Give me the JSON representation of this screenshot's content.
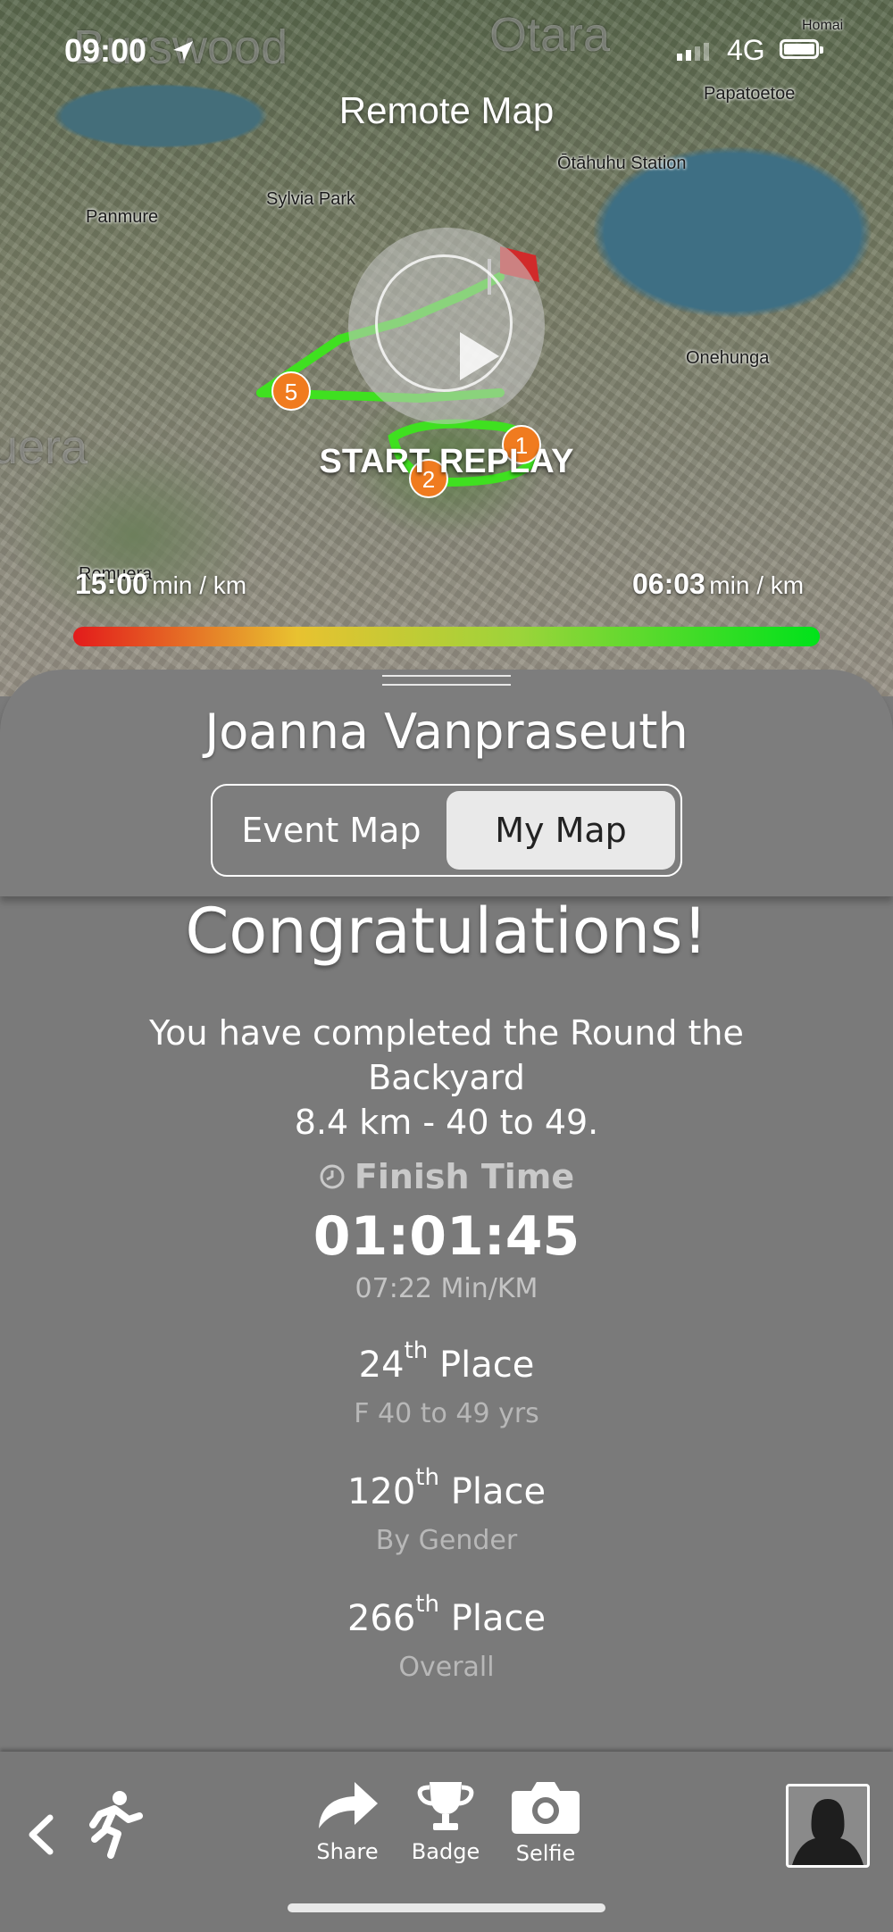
{
  "status_bar": {
    "time": "09:00",
    "network": "4G"
  },
  "map": {
    "title": "Remote Map",
    "places": [
      "Burswood",
      "Otara",
      "Papatoetoe",
      "Homai",
      "Sylvia Park",
      "Panmure",
      "Ōtāhuhu Station",
      "Onehunga",
      "Remuera",
      "uera"
    ],
    "replay_label": "START REPLAY",
    "markers": [
      "5",
      "1",
      "2"
    ],
    "pace_slow_value": "15:00",
    "pace_fast_value": "06:03",
    "pace_unit": "min / km",
    "colors": {
      "slow": "#e31b1b",
      "fast": "#00e21a",
      "route": "#3fe020",
      "marker": "#f07b1f"
    }
  },
  "panel": {
    "runner_name": "Joanna Vanpraseuth",
    "tabs": [
      {
        "label": "Event Map",
        "selected": false
      },
      {
        "label": "My Map",
        "selected": true
      }
    ]
  },
  "result": {
    "heading": "Congratulations!",
    "message_line1": "You have completed the Round the Backyard",
    "message_line2": "8.4 km - 40 to 49.",
    "finish_label": "Finish Time",
    "finish_time": "01:01:45",
    "finish_pace": "07:22 Min/KM",
    "places": [
      {
        "number": "24",
        "suffix": "th",
        "word": "Place",
        "subtitle": "F 40 to 49 yrs"
      },
      {
        "number": "120",
        "suffix": "th",
        "word": "Place",
        "subtitle": "By Gender"
      },
      {
        "number": "266",
        "suffix": "th",
        "word": "Place",
        "subtitle": "Overall"
      }
    ]
  },
  "toolbar": {
    "share_label": "Share",
    "badge_label": "Badge",
    "selfie_label": "Selfie"
  }
}
